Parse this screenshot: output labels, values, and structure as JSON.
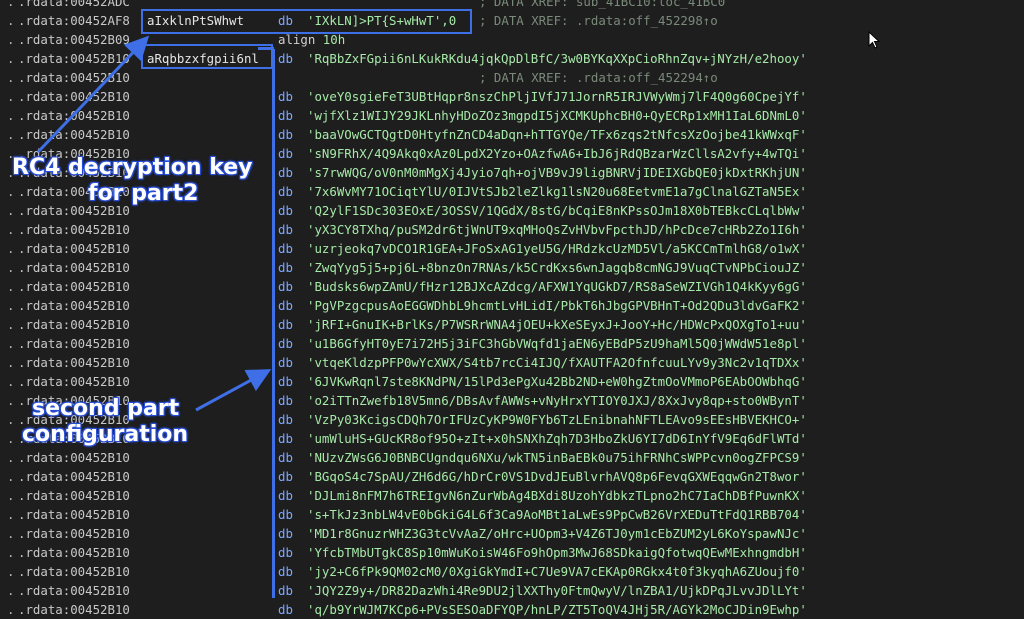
{
  "listing": {
    "top_rows": [
      {
        "addr": ".rdata:00452ADC",
        "label": "",
        "mnem": "",
        "text": "",
        "comment": "; DATA XREF: sub_41BC10:loc_41BC0"
      },
      {
        "addr": ".rdata:00452AF8",
        "label": "aIxklnPtSWhwt",
        "mnem": "db",
        "text": "'IXkLN]>PT{S+wHwT',0",
        "comment": "; DATA XREF: .rdata:off_452298↑o"
      },
      {
        "addr": ".rdata:00452B09",
        "label": "",
        "mnem": "",
        "text": "",
        "comment": ""
      },
      {
        "addr": ".rdata:00452B10",
        "label": "aRqbbzxfgpii6nl",
        "mnem": "db",
        "text": "'RqBbZxFGpii6nLKukRKdu4jqkQpDlBfC/3w0BYKqXXpCioRhnZqv+jNYzH/e2hooy'",
        "comment": ""
      },
      {
        "addr": ".rdata:00452B10",
        "label": "",
        "mnem": "",
        "text": "",
        "comment": "; DATA XREF: .rdata:off_452294↑o"
      }
    ],
    "align_keyword": "align",
    "align_value": "10h",
    "data_addr": ".rdata:00452B10",
    "data_mnem": "db",
    "data_rows": [
      "'oveY0sgieFeT3UBtHqpr8nszChPljIVfJ71JornR5IRJVWyWmj7lF4Q0g60CpejYf'",
      "'wjfXlz1WIJY29JKLnhyHDoZOz3mgpdI5jXCMKUphcBH0+QyECRp1xMH1IaL6DNmL0'",
      "'baaVOwGCTQgtD0HtyfnZnCD4aDqn+hTTGYQe/TFx6zqs2tNfcsXzOojbe41kWWxqF'",
      "'sN9FRhX/4Q9Akq0xAz0LpdX2Yzo+OAzfwA6+IbJ6jRdQBzarWzCllsA2vfy+4wTQi'",
      "'s7rwWQG/oV0nM0mMgXj4Jyio7qh+ojVB9vJ9ligBNRVjIDEIXGbQE0jkDxtRKhjUN'",
      "'7x6WvMY71OCiqtYlU/0IJVtSJb2leZlkg1lsN20u68EetvmE1a7gClnalGZTaN5Ex'",
      "'Q2ylF1SDc303EOxE/3OSSV/1QGdX/8stG/bCqiE8nKPssOJm18X0bTEBkcCLqlbWw'",
      "'yX3CY8TXhq/puSM2dr6tjWnUT9xqMHoQsZvHVbvFpcthJD/hPcDce7cHRb2Zo1I6h'",
      "'uzrjeokq7vDCO1R1GEA+JFoSxAG1yeU5G/HRdzkcUzMD5Vl/a5KCCmTmlhG8/o1wX'",
      "'ZwqYyg5j5+pj6L+8bnzOn7RNAs/k5CrdKxs6wnJagqb8cmNGJ9VuqCTvNPbCiouJZ'",
      "'Budsks6wpZAmU/fHzr12BJXcAZdcg/AFXW1YqUGkD7/RS8aSeWZIVGh1Q4kKyy6gG'",
      "'PgVPzgcpusAoEGGWDhbL9hcmtLvHLidI/PbkT6hJbgGPVBHnT+Od2QDu3ldvGaFK2'",
      "'jRFI+GnuIK+BrlKs/P7WSRrWNA4jOEU+kXeSEyxJ+JooY+Hc/HDWcPxQOXgTo1+uu'",
      "'u1B6GfyHT0yE7i72H5j3iFC3hGbVWqfd1jaEN6yEBdP5zU9haMl5Q0jWWdW51e8pl'",
      "'vtqeKldzpPFP0wYcXWX/S4tb7rcCi4IJQ/fXAUTFA2OfnfcuuLYv9y3Nc2v1qTDXx'",
      "'6JVKwRqnl7ste8KNdPN/15lPd3ePgXu42Bb2ND+eW0hgZtmOoVMmoP6EAbOOWbhqG'",
      "'o2iTTnZwefb18V5mn6/DBsAvfAWWs+vNyHrxYTIOY0JXJ/8XxJvy8qp+sto0WBynT'",
      "'VzPy03KcigsCDQh7OrIFUzCyKP9W0FYb6TzLEnibnahNFTLEAvo9sEEsHBVEKHCO+'",
      "'umWluHS+GUcKR8of95O+zIt+x0hSNXhZqh7D3HboZkU6YI7dD6InYfV9Eq6dFlWTd'",
      "'NUzvZWsG6J0BNBCUgndqu6NXu/wkTN5inBaEBk0u75ihFRNhCsWPPcvn0ogZFPCS9'",
      "'BGqoS4c7SpAU/ZH6d6G/hDrCr0VS1DvdJEuBlvrhAVQ8p6FevqGXWEqqwGn2T8wor'",
      "'DJLmi8nFM7h6TREIgvN6nZurWbAg4BXdi8UzohYdbkzTLpno2hC7IaChDBfPuwnKX'",
      "'s+TkJz3nbLW4vE0bGkiG4L6f3Ca9AoMBt1aLwEs9PpCwB26VrXEDuTtFdQ1RBB704'",
      "'MD1r8GnuzrWHZ3G3tcVvAaZ/oHrc+UOpm3+V4Z6TJ0ym1cEbZUM2yL6KoYspawNJc'",
      "'YfcbTMbUTgkC8Sp10mWuKoisW46Fo9hOpm3MwJ68SDkaigQfotwqQEwMExhngmdbH'",
      "'jy2+C6fPk9QM02cM0/0XgiGkYmdI+C7Ue9VA7cEKAp0RGkx4t0f3kyqhA6ZUoujf0'",
      "'JQY2Z9y+/DR82DazWhi4Re9DU2jlXXThy0FtmQwyV/lnZBA1/UjkDPqJLvvJDlLYt'",
      "'q/b9YrWJM7KCp6+PVsSESOaDFYQP/hnLP/ZT5ToQV4JHj5R/AGYk2MoCJDin9Ewhp'"
    ]
  },
  "annotations": {
    "rc4_line1": "RC4 decryption key",
    "rc4_line2": "for part2",
    "second_line1": "second part",
    "second_line2": "configuration"
  }
}
